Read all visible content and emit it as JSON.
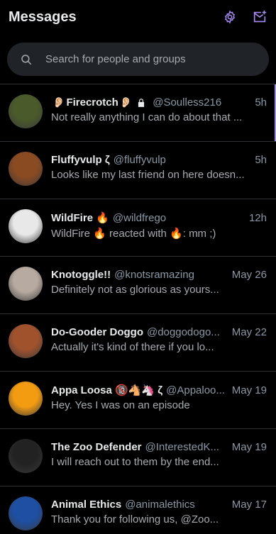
{
  "header": {
    "title": "Messages",
    "settings_icon": "gear-icon",
    "compose_icon": "new-message-icon"
  },
  "search": {
    "placeholder": "Search for people and groups"
  },
  "conversations": [
    {
      "name": "Firecrotch",
      "prefix_emoji": "👂🏻",
      "suffix_emoji": "👂🏻",
      "locked": true,
      "handle": "@Soulless216",
      "time": "5h",
      "preview": "Not really anything I can do about that ...",
      "avatar_color": "#4b5a2b",
      "selected": true
    },
    {
      "name": "Fluffyvulp ζ",
      "handle": "@fluffyvulp",
      "time": "5h",
      "preview": "Looks like my last friend on here doesn...",
      "avatar_color": "#8a4a22"
    },
    {
      "name": "WildFire 🔥",
      "handle": "@wildfrego",
      "time": "12h",
      "preview": "WildFire 🔥 reacted with 🔥: mm ;)",
      "avatar_color": "#e8e8e8"
    },
    {
      "name": "Knotoggle!!",
      "handle": "@knotsramazing",
      "time": "May 26",
      "preview": "Definitely not as glorious as yours...",
      "avatar_color": "#b7aaa0"
    },
    {
      "name": "Do-Gooder Doggo",
      "handle": "@doggodogo...",
      "time": "May 22",
      "preview": "Actually it's kind of there if you lo...",
      "avatar_color": "#a0522d"
    },
    {
      "name": "Appa Loosa 🔞🐴🦄 ζ",
      "handle": "@Appaloo...",
      "time": "May 19",
      "preview": "Hey. Yes I was on an episode",
      "avatar_color": "#f39c12"
    },
    {
      "name": "The Zoo Defender",
      "handle": "@InterestedK...",
      "time": "May 19",
      "preview": "I will reach out to them by the end...",
      "avatar_color": "#222222"
    },
    {
      "name": "Animal Ethics",
      "handle": "@animalethics",
      "time": "May 17",
      "preview": "Thank you for following us, @Zoo...",
      "avatar_color": "#1e4fa3"
    }
  ]
}
